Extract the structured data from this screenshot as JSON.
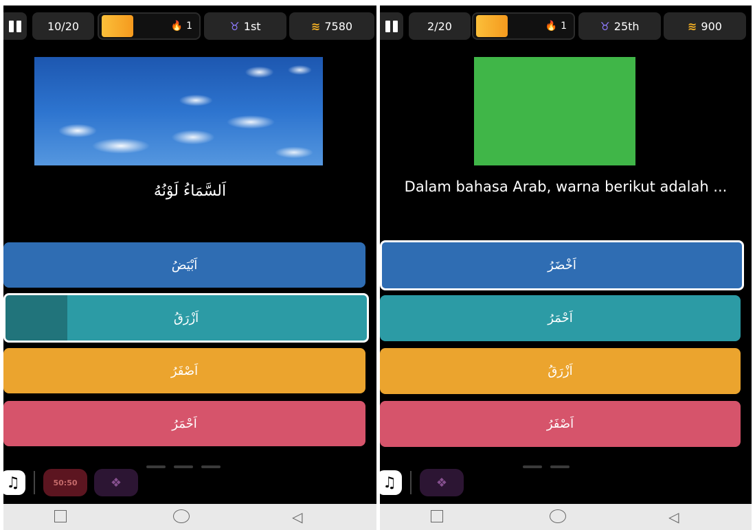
{
  "left": {
    "progress": "10/20",
    "streak": "1",
    "rank": "1st",
    "coins": "7580",
    "question": "اَلسَّمَاءُ لَوْنُهُ",
    "answers": [
      "اَبْيَضُ",
      "اَزْرَقُ",
      "اَصْفَرُ",
      "اَحْمَرُ"
    ],
    "power_label": "50:50"
  },
  "right": {
    "progress": "2/20",
    "streak": "1",
    "rank": "25th",
    "coins": "900",
    "question": "Dalam bahasa Arab, warna berikut adalah ...",
    "answers": [
      "اَخْضَرُ",
      "اَحْمَرُ",
      "اَزْرَقُ",
      "اَصْفَرُ"
    ],
    "swatch_color": "#40b648"
  },
  "colors": {
    "blue": "#2f6db3",
    "teal": "#2c9ba5",
    "yellow": "#eba42e",
    "red": "#d6546b"
  },
  "icons": [
    "pause-icon",
    "flame-icon",
    "medal-icon",
    "coins-icon",
    "music-icon",
    "home-square-icon",
    "home-circle-icon",
    "back-triangle-icon"
  ]
}
